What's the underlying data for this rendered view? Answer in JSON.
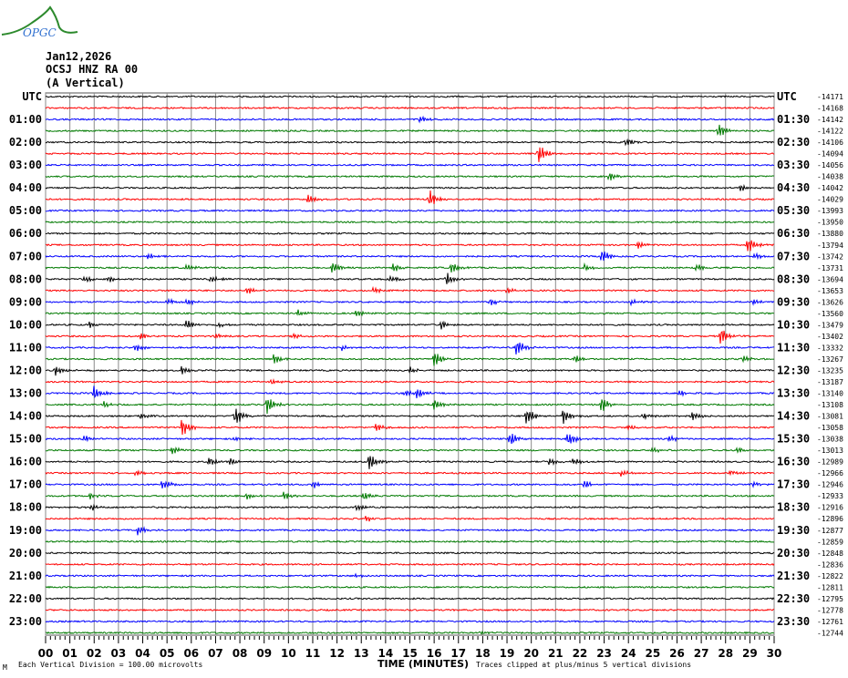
{
  "logo_text": "OPGC",
  "header": {
    "date": "Jan12,2026",
    "station": "OCSJ HNZ RA 00",
    "component": "(A Vertical)"
  },
  "footer": {
    "corner_mark": "Μ",
    "scale_note": "Each Vertical Division =  100.00 microvolts",
    "xlabel": "TIME (MINUTES)",
    "clip_note": "Traces clipped at plus/minus 5 vertical divisions"
  },
  "colors": {
    "trace": [
      "#000000",
      "#ff0000",
      "#0000ff",
      "#007a00"
    ],
    "grid": "#8a8a8a"
  },
  "chart_data": {
    "type": "line",
    "title": "OCSJ HNZ RA 00 helicorder",
    "xlabel": "TIME (MINUTES)",
    "xlim": [
      0,
      30
    ],
    "x_ticks": [
      "00",
      "01",
      "02",
      "03",
      "04",
      "05",
      "06",
      "07",
      "08",
      "09",
      "10",
      "11",
      "12",
      "13",
      "14",
      "15",
      "16",
      "17",
      "18",
      "19",
      "20",
      "21",
      "22",
      "23",
      "24",
      "25",
      "26",
      "27",
      "28",
      "29",
      "30"
    ],
    "rows_per_hour": 2,
    "row_count": 48,
    "left_labels": [
      "UTC",
      "",
      "01:00",
      "",
      "02:00",
      "",
      "03:00",
      "",
      "04:00",
      "",
      "05:00",
      "",
      "06:00",
      "",
      "07:00",
      "",
      "08:00",
      "",
      "09:00",
      "",
      "10:00",
      "",
      "11:00",
      "",
      "12:00",
      "",
      "13:00",
      "",
      "14:00",
      "",
      "15:00",
      "",
      "16:00",
      "",
      "17:00",
      "",
      "18:00",
      "",
      "19:00",
      "",
      "20:00",
      "",
      "21:00",
      "",
      "22:00",
      "",
      "23:00",
      ""
    ],
    "right_labels": [
      "UTC",
      "",
      "01:30",
      "",
      "02:30",
      "",
      "03:30",
      "",
      "04:30",
      "",
      "05:30",
      "",
      "06:30",
      "",
      "07:30",
      "",
      "08:30",
      "",
      "09:30",
      "",
      "10:30",
      "",
      "11:30",
      "",
      "12:30",
      "",
      "13:30",
      "",
      "14:30",
      "",
      "15:30",
      "",
      "16:30",
      "",
      "17:30",
      "",
      "18:30",
      "",
      "19:30",
      "",
      "20:30",
      "",
      "21:30",
      "",
      "22:30",
      "",
      "23:30",
      ""
    ],
    "row_offsets": [
      "-14171",
      "-14168",
      "-14142",
      "-14122",
      "-14106",
      "-14094",
      "-14056",
      "-14038",
      "-14042",
      "-14029",
      "-13993",
      "-13950",
      "-13880",
      "-13794",
      "-13742",
      "-13731",
      "-13694",
      "-13653",
      "-13626",
      "-13560",
      "-13479",
      "-13402",
      "-13332",
      "-13267",
      "-13235",
      "-13187",
      "-13140",
      "-13108",
      "-13081",
      "-13058",
      "-13038",
      "-13013",
      "-12989",
      "-12966",
      "-12946",
      "-12933",
      "-12916",
      "-12896",
      "-12877",
      "-12859",
      "-12848",
      "-12836",
      "-12822",
      "-12811",
      "-12795",
      "-12778",
      "-12761",
      "-12744"
    ],
    "events_row_minute_amplitude": [
      [
        2,
        15.4,
        2
      ],
      [
        3,
        27.7,
        5
      ],
      [
        4,
        23.9,
        2.5
      ],
      [
        5,
        20.3,
        5
      ],
      [
        7,
        23.2,
        3
      ],
      [
        8,
        28.6,
        2
      ],
      [
        9,
        10.8,
        3
      ],
      [
        9,
        15.8,
        5
      ],
      [
        13,
        28.9,
        5
      ],
      [
        13,
        24.4,
        2
      ],
      [
        14,
        22.9,
        4
      ],
      [
        14,
        4.2,
        2
      ],
      [
        14,
        29.2,
        2
      ],
      [
        15,
        11.8,
        3
      ],
      [
        15,
        14.3,
        2.5
      ],
      [
        15,
        5.8,
        2
      ],
      [
        15,
        22.2,
        2
      ],
      [
        15,
        26.8,
        2
      ],
      [
        15,
        16.7,
        3
      ],
      [
        16,
        1.6,
        2
      ],
      [
        16,
        2.6,
        2
      ],
      [
        16,
        6.8,
        2
      ],
      [
        16,
        16.5,
        4
      ],
      [
        16,
        14.2,
        2
      ],
      [
        17,
        8.3,
        2.5
      ],
      [
        17,
        19,
        2
      ],
      [
        17,
        13.5,
        1.5
      ],
      [
        18,
        5,
        2
      ],
      [
        18,
        5.8,
        2
      ],
      [
        18,
        18.3,
        2
      ],
      [
        18,
        24.1,
        2
      ],
      [
        18,
        29.1,
        2
      ],
      [
        19,
        10.4,
        2
      ],
      [
        19,
        12.8,
        2
      ],
      [
        20,
        1.8,
        2
      ],
      [
        20,
        5.8,
        3
      ],
      [
        20,
        16.3,
        2.5
      ],
      [
        20,
        7.1,
        1.5
      ],
      [
        21,
        27.8,
        5
      ],
      [
        21,
        3.9,
        2
      ],
      [
        21,
        10.2,
        2
      ],
      [
        21,
        7,
        1.5
      ],
      [
        22,
        19.4,
        5
      ],
      [
        22,
        3.7,
        2.5
      ],
      [
        22,
        12.2,
        1.5
      ],
      [
        23,
        9.4,
        3
      ],
      [
        23,
        21.8,
        2.5
      ],
      [
        23,
        16,
        5
      ],
      [
        23,
        28.7,
        2
      ],
      [
        24,
        0.4,
        3
      ],
      [
        24,
        5.6,
        3
      ],
      [
        24,
        15,
        2
      ],
      [
        25,
        9.3,
        2
      ],
      [
        26,
        2,
        4
      ],
      [
        26,
        14.8,
        2
      ],
      [
        26,
        15.3,
        2.5
      ],
      [
        26,
        26.1,
        2
      ],
      [
        27,
        16,
        3
      ],
      [
        27,
        9.1,
        5
      ],
      [
        27,
        22.9,
        4
      ],
      [
        27,
        2.4,
        2
      ],
      [
        28,
        7.8,
        5
      ],
      [
        28,
        19.8,
        5
      ],
      [
        28,
        21.3,
        5
      ],
      [
        28,
        3.9,
        1.5
      ],
      [
        28,
        24.6,
        1.5
      ],
      [
        28,
        26.6,
        3
      ],
      [
        29,
        5.6,
        5
      ],
      [
        29,
        13.6,
        2.5
      ],
      [
        29,
        24,
        1.5
      ],
      [
        30,
        1.6,
        2
      ],
      [
        30,
        19.1,
        4
      ],
      [
        30,
        21.5,
        5
      ],
      [
        30,
        25.7,
        2
      ],
      [
        30,
        7.8,
        1.5
      ],
      [
        31,
        5.2,
        3
      ],
      [
        31,
        28.5,
        2
      ],
      [
        31,
        25,
        1.5
      ],
      [
        32,
        6.7,
        3
      ],
      [
        32,
        13.3,
        5
      ],
      [
        32,
        20.7,
        2.5
      ],
      [
        32,
        21.7,
        2
      ],
      [
        32,
        7.6,
        2
      ],
      [
        33,
        3.7,
        1.5
      ],
      [
        33,
        23.7,
        2
      ],
      [
        33,
        28.2,
        1.5
      ],
      [
        34,
        4.8,
        3
      ],
      [
        34,
        11,
        2
      ],
      [
        34,
        22.2,
        2
      ],
      [
        34,
        29.1,
        1.5
      ],
      [
        35,
        1.8,
        2
      ],
      [
        35,
        9.8,
        3
      ],
      [
        35,
        13.1,
        3
      ],
      [
        35,
        8.3,
        1.5
      ],
      [
        36,
        1.9,
        2
      ],
      [
        36,
        12.8,
        2
      ],
      [
        37,
        13.2,
        1.5
      ],
      [
        38,
        3.8,
        3
      ],
      [
        42,
        12.8,
        1
      ],
      [
        47,
        17.9,
        1
      ]
    ]
  }
}
